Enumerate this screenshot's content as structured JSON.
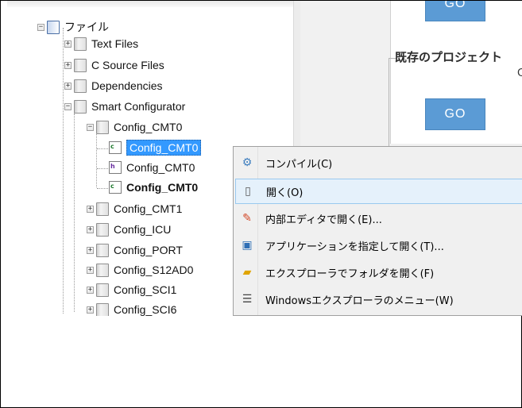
{
  "tree": {
    "root": {
      "label": "ファイル"
    },
    "items": [
      {
        "label": "Text Files"
      },
      {
        "label": "C Source Files"
      },
      {
        "label": "Dependencies"
      },
      {
        "label": "Smart Configurator"
      },
      {
        "label": "Config_CMT0"
      },
      {
        "label": "Config_CMT0"
      },
      {
        "label": "Config_CMT0"
      },
      {
        "label": "Config_CMT0"
      },
      {
        "label": "Config_CMT1"
      },
      {
        "label": "Config_ICU"
      },
      {
        "label": "Config_PORT"
      },
      {
        "label": "Config_S12AD0"
      },
      {
        "label": "Config_SCI1"
      },
      {
        "label": "Config_SCI6"
      }
    ]
  },
  "right_panel": {
    "go_top": "GO",
    "section_title": "既存のプロジェクト",
    "section_sub": "C",
    "go_mid": "GO"
  },
  "context_menu": {
    "items": [
      {
        "label": "コンパイル(C)",
        "icon": "compile-icon"
      },
      {
        "label": "開く(O)",
        "icon": "open-icon",
        "highlighted": true
      },
      {
        "label": "内部エディタで開く(E)...",
        "icon": "edit-icon"
      },
      {
        "label": "アプリケーションを指定して開く(T)...",
        "icon": "app-icon"
      },
      {
        "label": "エクスプローラでフォルダを開く(F)",
        "icon": "folder-icon"
      },
      {
        "label": "Windowsエクスプローラのメニュー(W)",
        "icon": "menu-icon"
      }
    ]
  },
  "colors": {
    "selection": "#3399ff",
    "go_button": "#5b9bd5",
    "menu_highlight": "#e5f1fb"
  }
}
